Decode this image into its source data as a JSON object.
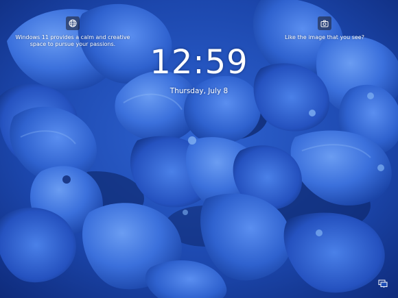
{
  "lockscreen": {
    "spotlight_left": {
      "icon": "globe-icon",
      "text": "Windows 11 provides a calm and creative space to pursue your passions."
    },
    "spotlight_right": {
      "icon": "camera-icon",
      "text": "Like the image that you see?"
    },
    "time": "12:59",
    "date": "Thursday, July 8",
    "status_icons": [
      "network-icon"
    ]
  },
  "colors": {
    "background_base": "#1f4fb8",
    "petal_light": "#4d87ea",
    "petal_mid": "#2f63cf",
    "petal_dark": "#0d2a78",
    "text": "#ffffff"
  }
}
